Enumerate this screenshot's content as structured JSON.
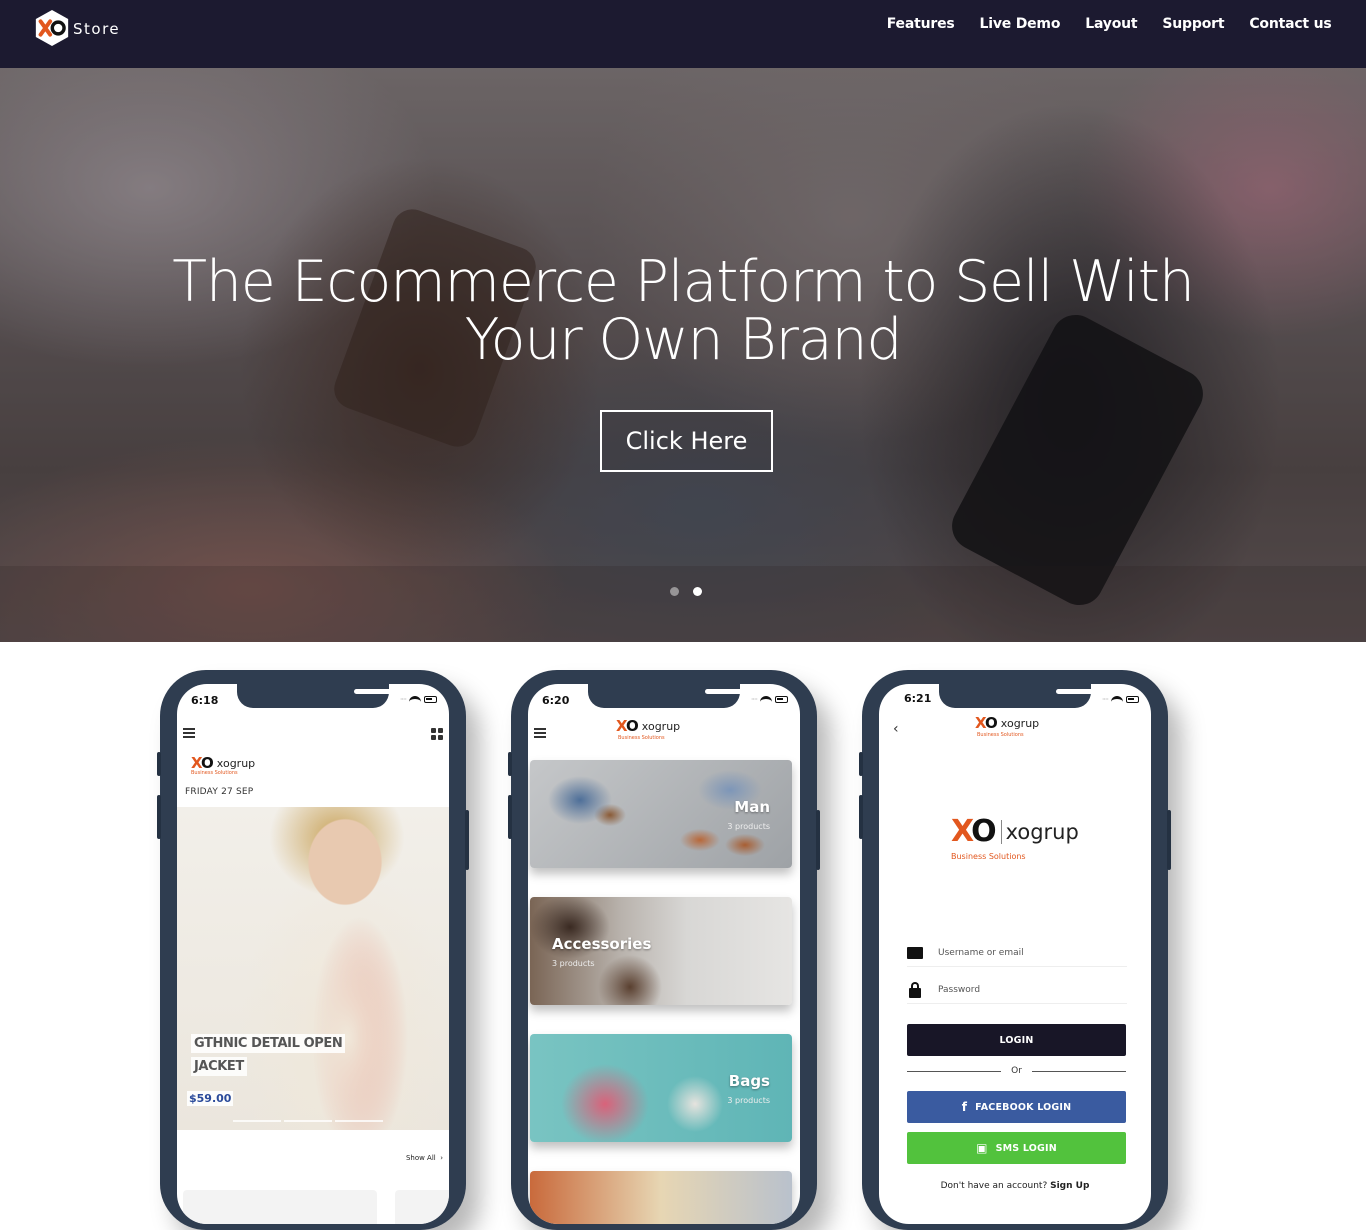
{
  "nav": {
    "logo_mark": "XO",
    "logo_text": "Store",
    "links": [
      "Features",
      "Live Demo",
      "Layout",
      "Support",
      "Contact us"
    ]
  },
  "hero": {
    "title_line1": "The Ecommerce Platform to Sell With",
    "title_line2": "Your Own Brand",
    "cta": "Click Here",
    "slide_count": 2,
    "active_slide": 2
  },
  "phone1": {
    "time": "6:18",
    "brand": "xogrup",
    "brand_sub": "Business Solutions",
    "date": "FRIDAY 27 SEP",
    "product_line1": "GTHNIC DETAIL OPEN",
    "product_line2": "JACKET",
    "price": "$59.00",
    "show_all": "Show All"
  },
  "phone2": {
    "time": "6:20",
    "brand": "xogrup",
    "brand_sub": "Business Solutions",
    "categories": [
      {
        "name": "Man",
        "count": "3 products"
      },
      {
        "name": "Accessories",
        "count": "3 products"
      },
      {
        "name": "Bags",
        "count": "3 products"
      }
    ]
  },
  "phone3": {
    "time": "6:21",
    "brand": "xogrup",
    "brand_sub": "Business Solutions",
    "username_placeholder": "Username or email",
    "password_placeholder": "Password",
    "login": "LOGIN",
    "or": "Or",
    "facebook_login": "FACEBOOK LOGIN",
    "sms_login": "SMS LOGIN",
    "signup_prompt": "Don't have an account?",
    "signup_link": "Sign Up"
  },
  "colors": {
    "navbar": "#1c1a30",
    "phone_frame": "#2f3d50",
    "brand_orange": "#e2571e",
    "login_button": "#181627",
    "facebook": "#3a5ba0",
    "sms": "#52c23d"
  }
}
